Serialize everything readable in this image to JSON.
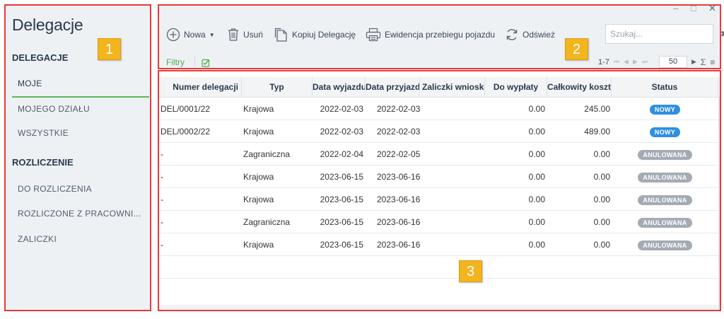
{
  "sidebar": {
    "title": "Delegacje",
    "sections": [
      {
        "title": "DELEGACJE",
        "items": [
          {
            "label": "MOJE",
            "active": true
          },
          {
            "label": "MOJEGO DZIAŁU"
          },
          {
            "label": "WSZYSTKIE"
          }
        ]
      },
      {
        "title": "ROZLICZENIE",
        "items": [
          {
            "label": "DO ROZLICZENIA"
          },
          {
            "label": "ROZLICZONE Z PRACOWNI..."
          },
          {
            "label": "ZALICZKI"
          }
        ]
      }
    ]
  },
  "toolbar": {
    "new_label": "Nowa",
    "delete_label": "Usuń",
    "copy_label": "Kopiuj Delegację",
    "mileage_label": "Ewidencja przebiegu pojazdu",
    "refresh_label": "Odśwież",
    "filters_label": "Filtry",
    "search_placeholder": "Szukaj...",
    "window_controls": [
      "–",
      "□",
      "✕"
    ]
  },
  "pager": {
    "range": "1-7",
    "page_size": "50"
  },
  "table": {
    "columns": [
      "Numer delegacji",
      "Typ",
      "Data wyjazdu",
      "Data przyjazdu",
      "Zaliczki wnioskowane",
      "Do wypłaty",
      "Całkowity koszt",
      "Status"
    ],
    "rows": [
      {
        "number": "DEL/0001/22",
        "type": "Krajowa",
        "departure": "2022-02-03",
        "arrival": "2022-02-03",
        "advance": "",
        "payout": "0.00",
        "total": "245.00",
        "status": "NOWY",
        "status_kind": "new"
      },
      {
        "number": "DEL/0002/22",
        "type": "Krajowa",
        "departure": "2022-02-03",
        "arrival": "2022-02-03",
        "advance": "",
        "payout": "0.00",
        "total": "489.00",
        "status": "NOWY",
        "status_kind": "new"
      },
      {
        "number": "-",
        "type": "Zagraniczna",
        "departure": "2022-02-04",
        "arrival": "2022-02-05",
        "advance": "",
        "payout": "0.00",
        "total": "0.00",
        "status": "ANULOWANA",
        "status_kind": "cancel"
      },
      {
        "number": "-",
        "type": "Krajowa",
        "departure": "2023-06-15",
        "arrival": "2023-06-16",
        "advance": "",
        "payout": "0.00",
        "total": "0.00",
        "status": "ANULOWANA",
        "status_kind": "cancel"
      },
      {
        "number": "-",
        "type": "Krajowa",
        "departure": "2023-06-15",
        "arrival": "2023-06-16",
        "advance": "",
        "payout": "0.00",
        "total": "0.00",
        "status": "ANULOWANA",
        "status_kind": "cancel"
      },
      {
        "number": "-",
        "type": "Zagraniczna",
        "departure": "2023-06-15",
        "arrival": "2023-06-16",
        "advance": "",
        "payout": "0.00",
        "total": "0.00",
        "status": "ANULOWANA",
        "status_kind": "cancel"
      },
      {
        "number": "-",
        "type": "Krajowa",
        "departure": "2023-06-15",
        "arrival": "2023-06-16",
        "advance": "",
        "payout": "0.00",
        "total": "0.00",
        "status": "ANULOWANA",
        "status_kind": "cancel"
      }
    ]
  },
  "annotations": {
    "labels": [
      "1",
      "2",
      "3"
    ],
    "frame_color": "#e8393c",
    "tag_color": "#f2b51e"
  },
  "colors": {
    "accent_green": "#5cb85c",
    "badge_new": "#2f8fe0",
    "badge_cancelled": "#a3abb4",
    "panel_bg": "#eef1f4"
  }
}
